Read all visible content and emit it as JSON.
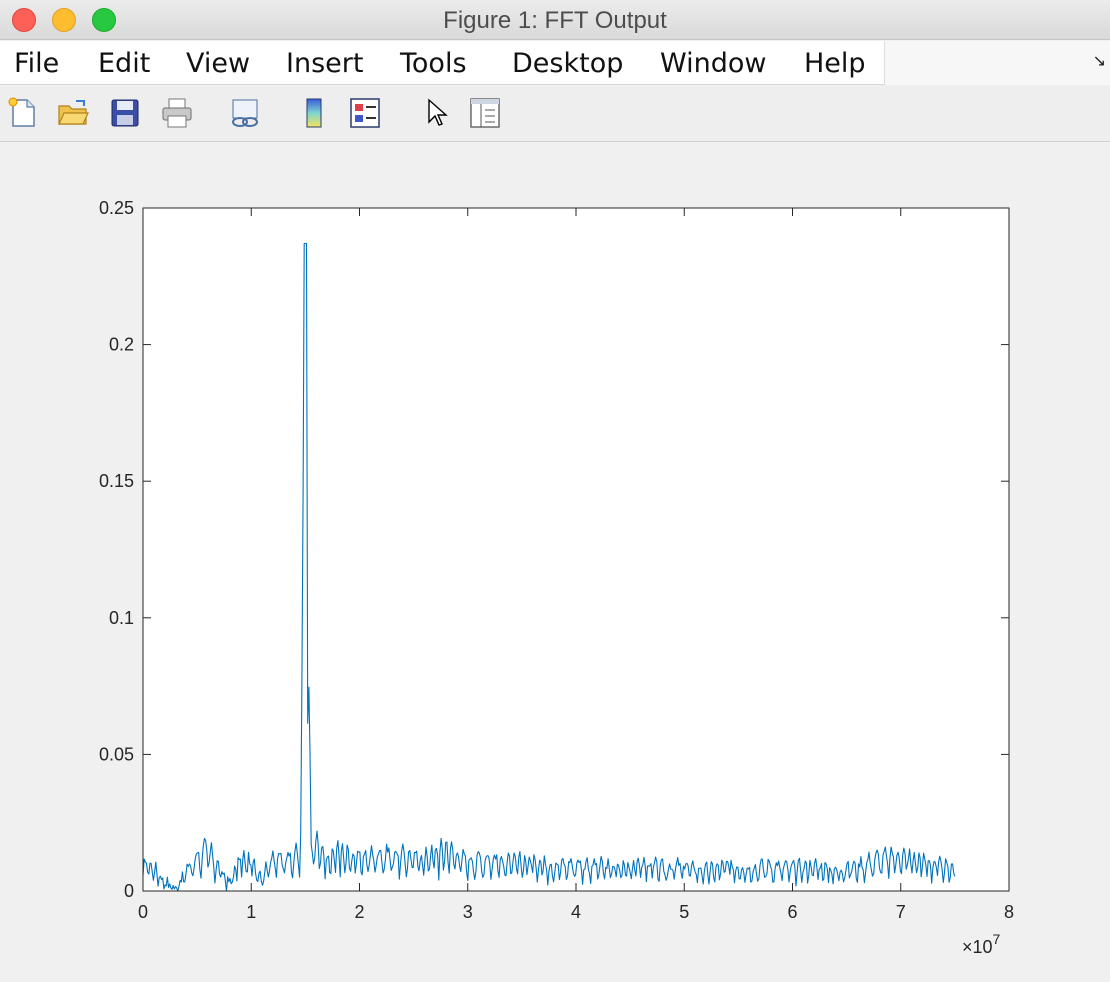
{
  "window": {
    "title": "Figure 1: FFT Output"
  },
  "menu": {
    "items": [
      "File",
      "Edit",
      "View",
      "Insert",
      "Tools",
      "Desktop",
      "Window",
      "Help"
    ],
    "overflow_icon": "corner-arrow-icon"
  },
  "toolbar": {
    "buttons": [
      {
        "icon": "new-figure-icon"
      },
      {
        "icon": "open-folder-icon"
      },
      {
        "icon": "save-disk-icon"
      },
      {
        "icon": "print-icon"
      },
      {
        "icon": "link-plot-icon"
      },
      {
        "icon": "colorbar-icon"
      },
      {
        "icon": "legend-icon"
      },
      {
        "icon": "pointer-arrow-icon"
      },
      {
        "icon": "property-editor-icon"
      }
    ]
  },
  "colors": {
    "line": "#0072bd",
    "axes_bg": "#ffffff",
    "figure_bg": "#f0f0f0"
  },
  "chart_data": {
    "type": "line",
    "title": "",
    "xlabel": "",
    "ylabel": "",
    "xlim": [
      0,
      8
    ],
    "ylim": [
      0,
      0.25
    ],
    "x_exponent_label": "×10",
    "x_exponent_power": "7",
    "x_ticks": [
      "0",
      "1",
      "2",
      "3",
      "4",
      "5",
      "6",
      "7",
      "8"
    ],
    "y_ticks": [
      "0",
      "0.05",
      "0.1",
      "0.15",
      "0.2",
      "0.25"
    ],
    "grid": false,
    "series": [
      {
        "x_range": [
          0,
          7.5
        ],
        "peak": {
          "x": 1.5,
          "y": 0.237
        },
        "x": [
          0,
          0.1,
          0.2,
          0.3,
          0.4,
          0.5,
          0.6,
          0.7,
          0.8,
          0.9,
          1.0,
          1.1,
          1.2,
          1.3,
          1.4,
          1.45,
          1.5,
          1.55,
          1.6,
          1.7,
          1.8,
          1.9,
          2.0,
          2.2,
          2.4,
          2.6,
          2.8,
          3.0,
          3.2,
          3.4,
          3.6,
          3.8,
          4.0,
          4.2,
          4.4,
          4.6,
          4.8,
          5.0,
          5.2,
          5.4,
          5.6,
          5.8,
          6.0,
          6.2,
          6.4,
          6.6,
          6.8,
          7.0,
          7.2,
          7.5
        ],
        "y": [
          0.012,
          0.009,
          0.004,
          0.001,
          0.008,
          0.014,
          0.017,
          0.009,
          0.003,
          0.013,
          0.011,
          0.006,
          0.014,
          0.012,
          0.016,
          0.01,
          0.237,
          0.015,
          0.019,
          0.011,
          0.016,
          0.014,
          0.013,
          0.015,
          0.014,
          0.013,
          0.017,
          0.012,
          0.013,
          0.011,
          0.012,
          0.01,
          0.011,
          0.01,
          0.009,
          0.011,
          0.009,
          0.01,
          0.008,
          0.01,
          0.009,
          0.01,
          0.009,
          0.01,
          0.008,
          0.01,
          0.013,
          0.014,
          0.012,
          0.008
        ]
      }
    ]
  }
}
